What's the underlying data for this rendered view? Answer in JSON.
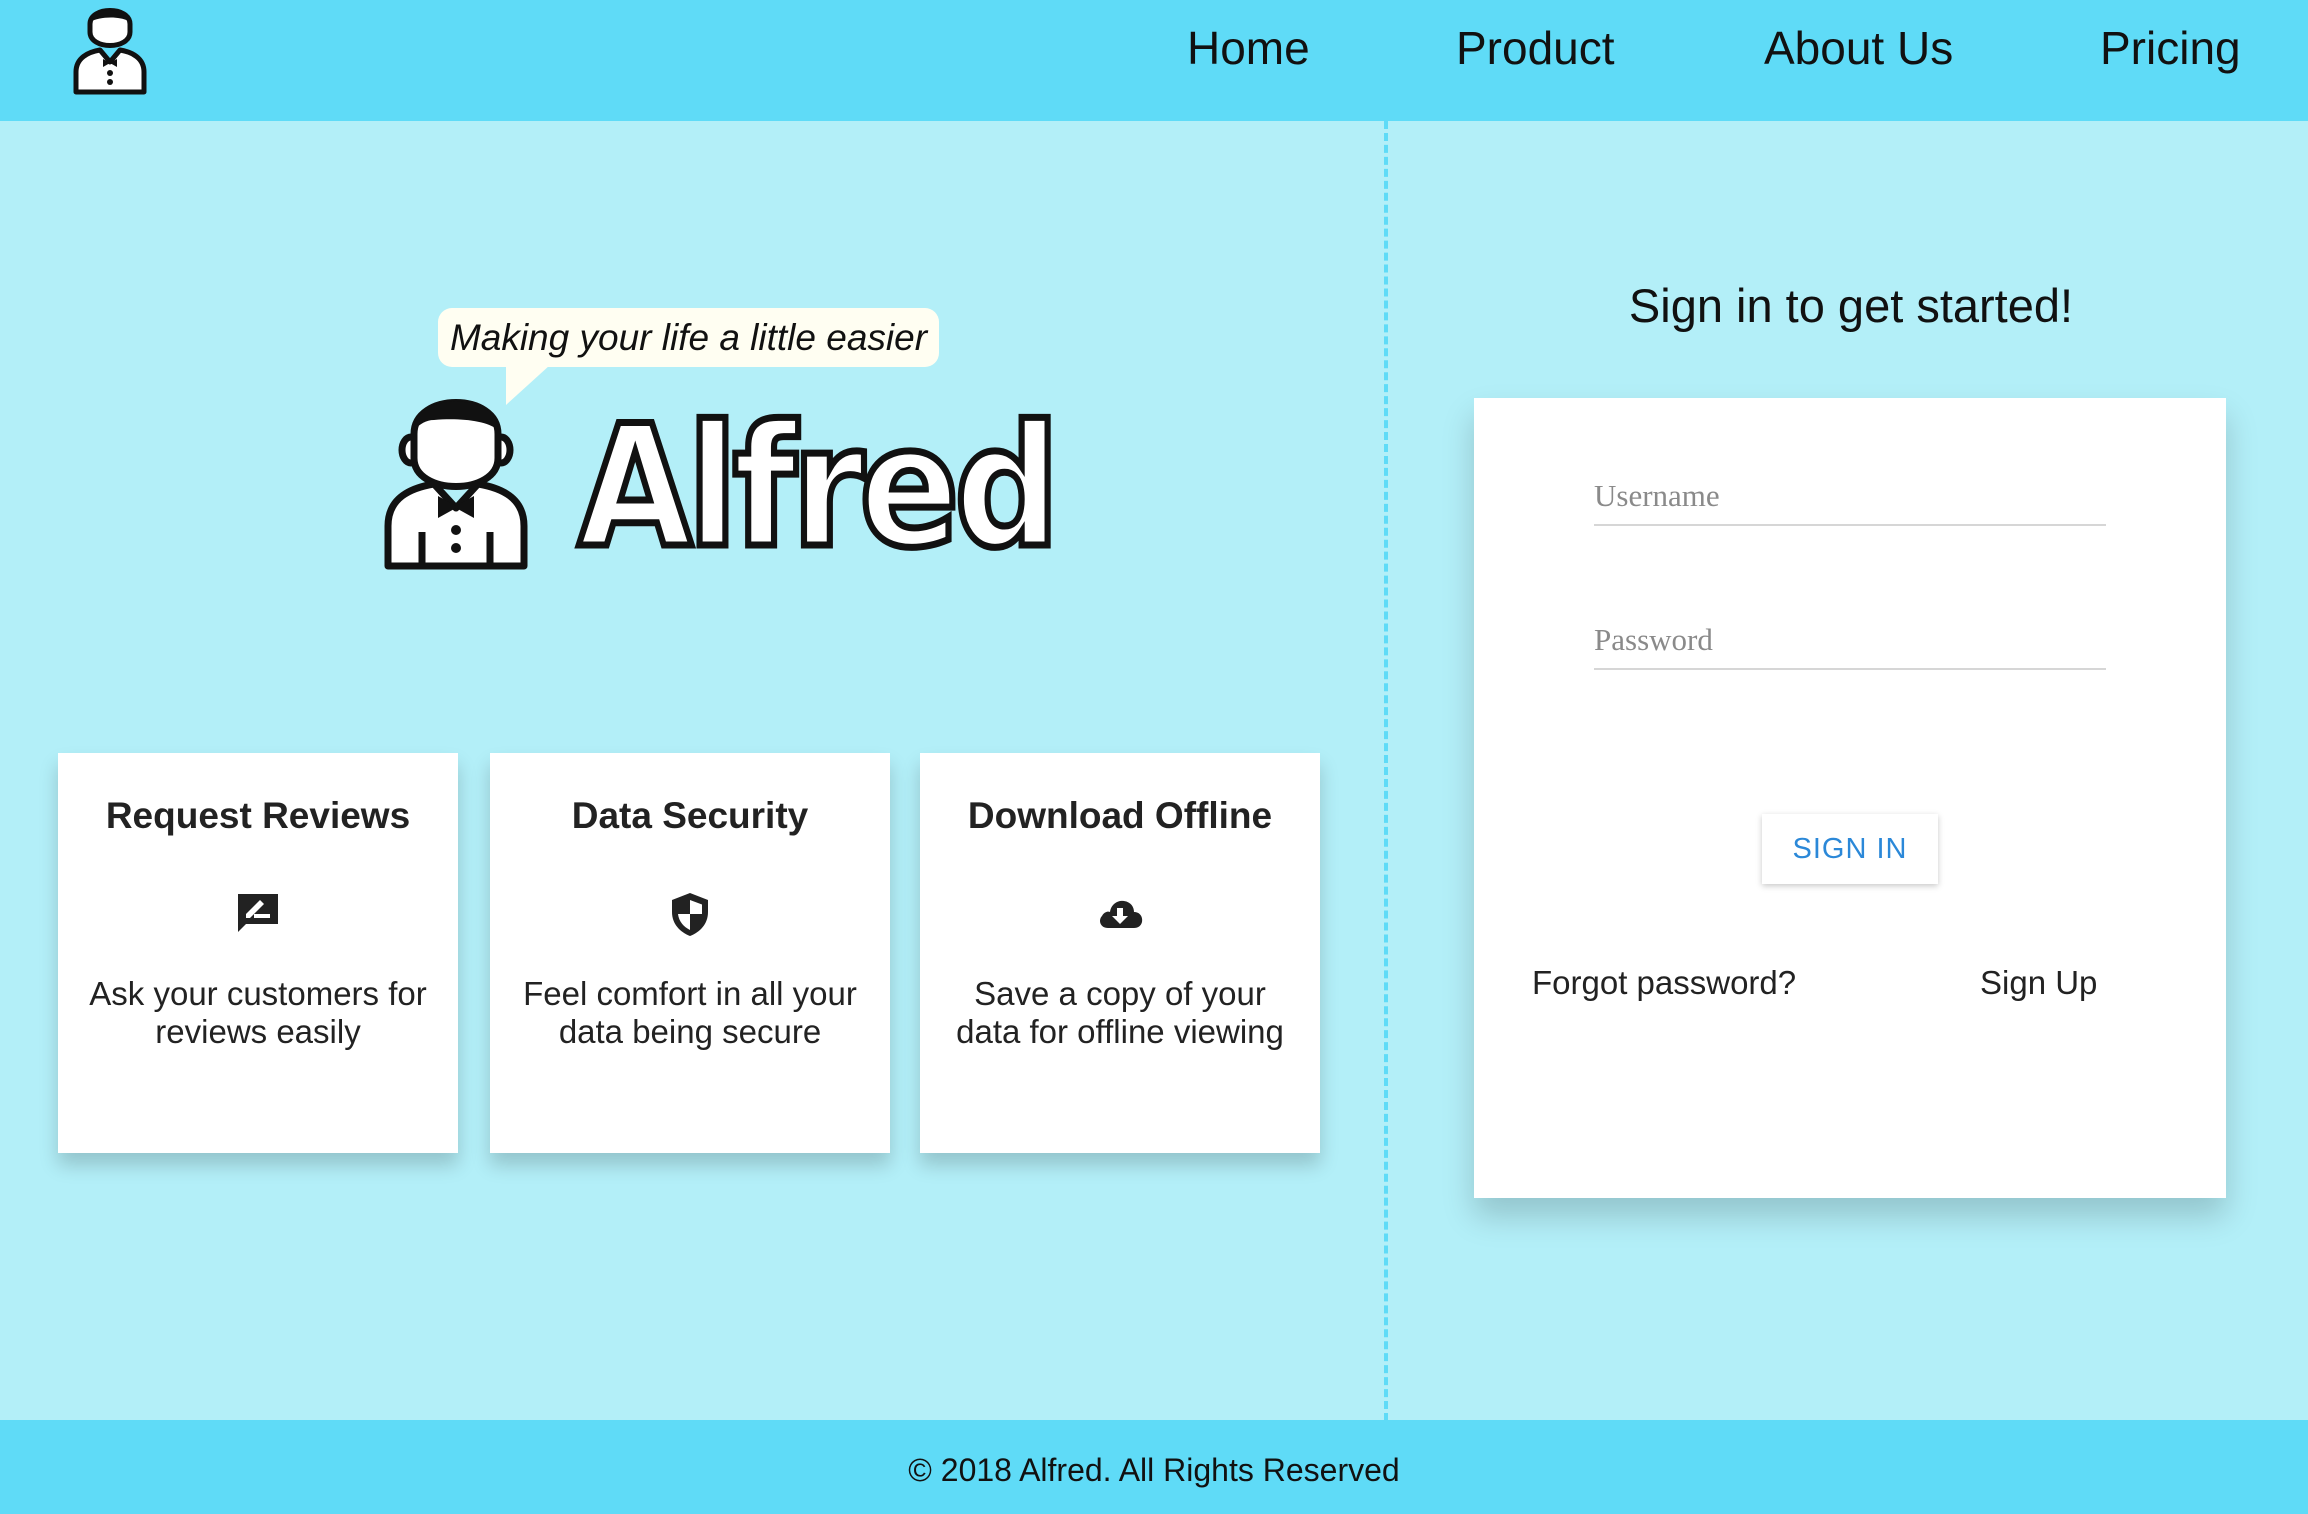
{
  "brand": {
    "name": "Alfred",
    "tagline": "Making your life a little easier",
    "logo_icon": "butler-icon"
  },
  "nav": {
    "items": [
      {
        "label": "Home"
      },
      {
        "label": "Product"
      },
      {
        "label": "About Us"
      },
      {
        "label": "Pricing"
      }
    ]
  },
  "features": [
    {
      "title": "Request Reviews",
      "icon": "rate-review-icon",
      "text": "Ask your customers for reviews easily"
    },
    {
      "title": "Data Security",
      "icon": "security-shield-icon",
      "text": "Feel comfort in all your data being secure"
    },
    {
      "title": "Download Offline",
      "icon": "cloud-download-icon",
      "text": "Save a copy of your data for offline viewing"
    }
  ],
  "signin": {
    "heading": "Sign in to get started!",
    "username_placeholder": "Username",
    "password_placeholder": "Password",
    "button_label": "SIGN IN",
    "forgot_label": "Forgot password?",
    "signup_label": "Sign Up"
  },
  "footer": {
    "text": "© 2018 Alfred. All Rights Reserved"
  },
  "colors": {
    "header_bg": "#5fdbf7",
    "page_bg": "#b3eff8",
    "card_bg": "#ffffff",
    "accent_blue": "#2b88d8"
  }
}
